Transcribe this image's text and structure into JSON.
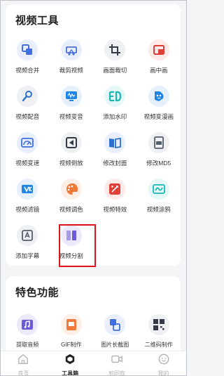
{
  "tools": {
    "title": "视频工具",
    "items": [
      {
        "label": "视频合并",
        "icon": "merge-icon",
        "bg": "#e8eefc",
        "fg": "#3f6fe0"
      },
      {
        "label": "裁剪视频",
        "icon": "crop-film-icon",
        "bg": "#e8eefc",
        "fg": "#4a72d8"
      },
      {
        "label": "画面裁切",
        "icon": "frame-crop-icon",
        "bg": "#eef0f3",
        "fg": "#333a45"
      },
      {
        "label": "画中画",
        "icon": "picture-in-picture-icon",
        "bg": "#fde9e8",
        "fg": "#e0403a"
      },
      {
        "label": "视频配音",
        "icon": "microphone-icon",
        "bg": "#eef0f3",
        "fg": "#2f6fd0"
      },
      {
        "label": "视频变音",
        "icon": "voice-change-icon",
        "bg": "#e6f0fd",
        "fg": "#1f86e8"
      },
      {
        "label": "添加水印",
        "icon": "watermark-icon",
        "bg": "#e5f7f6",
        "fg": "#19b8b2"
      },
      {
        "label": "视频变漫画",
        "icon": "comic-icon",
        "bg": "#e6f0fd",
        "fg": "#1f86e8"
      },
      {
        "label": "视频变速",
        "icon": "speed-icon",
        "bg": "#e8eefc",
        "fg": "#3f6fe0"
      },
      {
        "label": "视频倒放",
        "icon": "reverse-icon",
        "bg": "#eef0f3",
        "fg": "#333a45"
      },
      {
        "label": "修改封面",
        "icon": "cover-icon",
        "bg": "#e8eefc",
        "fg": "#2f6fd0"
      },
      {
        "label": "修改MD5",
        "icon": "md5-icon",
        "bg": "#eef0f3",
        "fg": "#555d6b"
      },
      {
        "label": "视频滤镜",
        "icon": "filter-icon",
        "bg": "#e6f0fd",
        "fg": "#1f86e8"
      },
      {
        "label": "视频调色",
        "icon": "palette-icon",
        "bg": "#fdeee6",
        "fg": "#f07a3a"
      },
      {
        "label": "视频特效",
        "icon": "effects-icon",
        "bg": "#fde9e8",
        "fg": "#e0403a"
      },
      {
        "label": "视频涂鸦",
        "icon": "doodle-icon",
        "bg": "#e5f7f6",
        "fg": "#19b8b2"
      },
      {
        "label": "添加字幕",
        "icon": "subtitle-icon",
        "bg": "#eef0f3",
        "fg": "#555d6b"
      },
      {
        "label": "视频分割",
        "icon": "split-icon",
        "bg": "#ece9fb",
        "fg": "#6a5cd8"
      }
    ]
  },
  "featured": {
    "title": "特色功能",
    "items": [
      {
        "label": "提取音频",
        "icon": "extract-audio-icon",
        "bg": "#ece9fb",
        "fg": "#6a5cd8"
      },
      {
        "label": "GIF制作",
        "icon": "gif-icon",
        "bg": "#fdeee6",
        "fg": "#f07a3a"
      },
      {
        "label": "图片长截图",
        "icon": "long-screenshot-icon",
        "bg": "#e8eefc",
        "fg": "#3f6fe0"
      },
      {
        "label": "二维码制作",
        "icon": "qrcode-icon",
        "bg": "#eef0f3",
        "fg": "#333a45"
      }
    ]
  },
  "tabbar": {
    "items": [
      {
        "label": "首页",
        "icon": "home-icon",
        "active": false
      },
      {
        "label": "工具箱",
        "icon": "toolbox-icon",
        "active": true
      },
      {
        "label": "剪同款",
        "icon": "video-camera-icon",
        "active": false
      },
      {
        "label": "我的",
        "icon": "profile-icon",
        "active": false
      }
    ]
  }
}
